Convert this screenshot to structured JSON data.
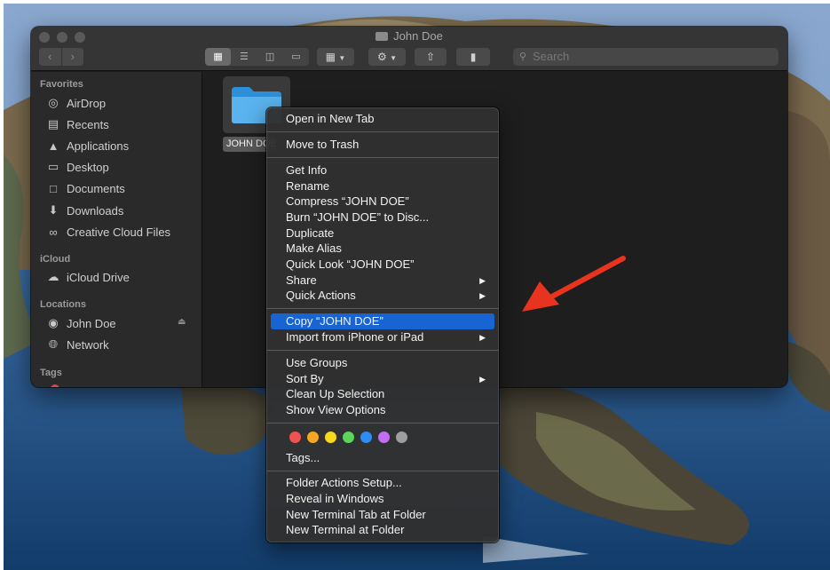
{
  "window": {
    "title": "John Doe",
    "search_placeholder": "Search"
  },
  "sidebar": {
    "favorites_header": "Favorites",
    "favorites": [
      {
        "label": "AirDrop",
        "icon": "airdrop-icon"
      },
      {
        "label": "Recents",
        "icon": "recents-icon"
      },
      {
        "label": "Applications",
        "icon": "applications-icon"
      },
      {
        "label": "Desktop",
        "icon": "desktop-icon"
      },
      {
        "label": "Documents",
        "icon": "documents-icon"
      },
      {
        "label": "Downloads",
        "icon": "downloads-icon"
      },
      {
        "label": "Creative Cloud Files",
        "icon": "creative-cloud-icon"
      }
    ],
    "icloud_header": "iCloud",
    "icloud": [
      {
        "label": "iCloud Drive",
        "icon": "cloud-icon"
      }
    ],
    "locations_header": "Locations",
    "locations": [
      {
        "label": "John Doe",
        "icon": "disk-icon"
      },
      {
        "label": "Network",
        "icon": "network-icon"
      }
    ],
    "tags_header": "Tags"
  },
  "content": {
    "folder_name": "JOHN DOE"
  },
  "context_menu": {
    "groups": [
      [
        "Open in New Tab"
      ],
      [
        "Move to Trash"
      ],
      [
        "Get Info",
        "Rename",
        "Compress “JOHN DOE”",
        "Burn “JOHN DOE” to Disc...",
        "Duplicate",
        "Make Alias",
        "Quick Look “JOHN DOE”",
        "Share",
        "Quick Actions"
      ],
      [
        "Copy “JOHN DOE”",
        "Import from iPhone or iPad"
      ],
      [
        "Use Groups",
        "Sort By",
        "Clean Up Selection",
        "Show View Options"
      ],
      [
        "Tags..."
      ],
      [
        "Folder Actions Setup...",
        "Reveal in Windows",
        "New Terminal Tab at Folder",
        "New Terminal at Folder"
      ]
    ],
    "highlighted": "Copy “JOHN DOE”",
    "tag_colors": [
      "#ef5350",
      "#f5a623",
      "#f8d81c",
      "#5bd65b",
      "#2f8cf0",
      "#c36df0",
      "#9e9e9e"
    ]
  },
  "colors": {
    "highlight": "#1764d2",
    "arrow": "#e8331f"
  }
}
